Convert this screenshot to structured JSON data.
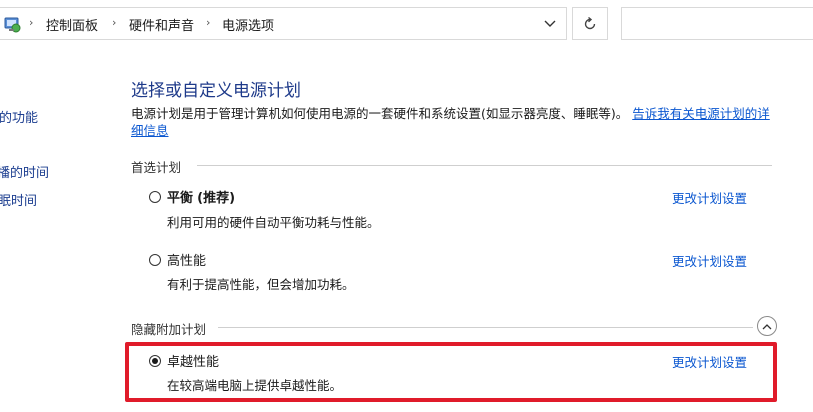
{
  "address_bar": {
    "breadcrumbs": [
      "控制面板",
      "硬件和声音",
      "电源选项"
    ],
    "separator": "›"
  },
  "left_pane": {
    "items": [
      "的功能",
      "播的时间",
      "眠时间"
    ]
  },
  "main": {
    "title": "选择或自定义电源计划",
    "description": "电源计划是用于管理计算机如何使用电源的一套硬件和系统设置(如显示器亮度、睡眠等)。",
    "description_link": "告诉我有关电源计划的详细信息",
    "preferred_section": "首选计划",
    "hidden_section": "隐藏附加计划",
    "plans": [
      {
        "name": "平衡",
        "name_suffix": "(推荐)",
        "desc": "利用可用的硬件自动平衡功耗与性能。",
        "link": "更改计划设置",
        "selected": false
      },
      {
        "name": "高性能",
        "name_suffix": "",
        "desc": "有利于提高性能，但会增加功耗。",
        "link": "更改计划设置",
        "selected": false
      },
      {
        "name": "卓越性能",
        "name_suffix": "",
        "desc": "在较高端电脑上提供卓越性能。",
        "link": "更改计划设置",
        "selected": true
      }
    ]
  },
  "colors": {
    "title_blue": "#1e3a8a",
    "link_blue": "#0b57d0",
    "highlight_red": "#e01b2a"
  }
}
